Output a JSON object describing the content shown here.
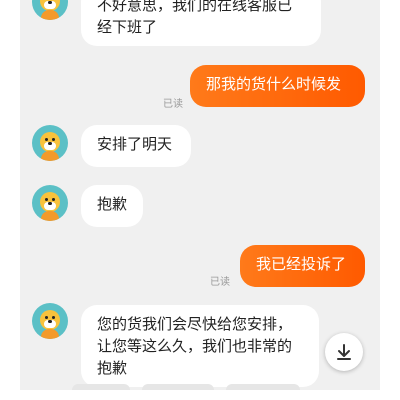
{
  "messages": [
    {
      "from": "agent",
      "text": "不好意思，我们的在线客服已经下班了"
    },
    {
      "from": "user",
      "text": "那我的货什么时候发",
      "status": "已读"
    },
    {
      "from": "agent",
      "text": "安排了明天"
    },
    {
      "from": "agent",
      "text": "抱歉"
    },
    {
      "from": "user",
      "text": "我已经投诉了",
      "status": "已读"
    },
    {
      "from": "agent",
      "text": "您的货我们会尽快给您安排，让您等这么久，我们也非常的抱歉"
    }
  ],
  "icons": {
    "avatar": "mascot-avatar-icon",
    "scroll_down": "arrow-down-to-line-icon"
  },
  "colors": {
    "user_bubble_start": "#ff7a1a",
    "user_bubble_end": "#ff5a00",
    "agent_bubble": "#ffffff",
    "chat_background": "#f0f0f0"
  }
}
